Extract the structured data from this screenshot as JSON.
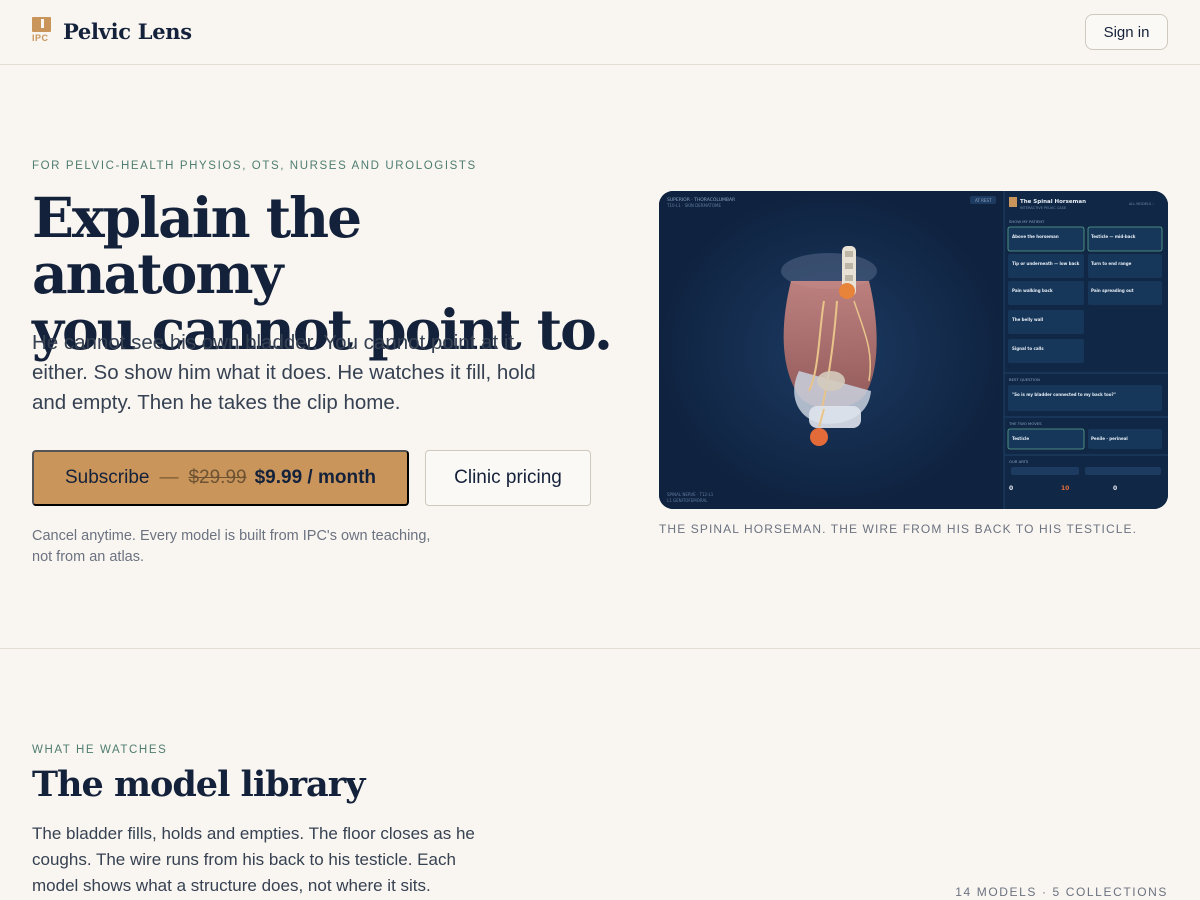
{
  "header": {
    "logo_text": "IPC",
    "brand": "Pelvic Lens",
    "signin_label": "Sign in"
  },
  "hero": {
    "eyebrow": "FOR PELVIC-HEALTH PHYSIOS, OTS, NURSES AND UROLOGISTS",
    "title_line1": "Explain the anatomy",
    "title_line2": "you cannot point to.",
    "subtitle": "He cannot see his own bladder. You cannot point at it either. So show him what it does. He watches it fill, hold and empty. Then he takes the clip home.",
    "subscribe": {
      "label": "Subscribe",
      "dash": "—",
      "old_price": "$29.99",
      "new_price": "$9.99 / month"
    },
    "clinic_label": "Clinic pricing",
    "fine_print": "Cancel anytime. Every model is built from IPC's own teaching, not from an atlas.",
    "caption": "THE SPINAL HORSEMAN. THE WIRE FROM HIS BACK TO HIS TESTICLE."
  },
  "preview": {
    "panel_title": "The Spinal Horseman",
    "panel_subtitle": "INTERACTIVE PELVIC CASE",
    "cards": [
      {
        "title": "Above the horseman"
      },
      {
        "title": "Testicle — mid-back"
      },
      {
        "title": "Tip or underneath — low back"
      },
      {
        "title": "Turn to end range"
      },
      {
        "title": "Pain walking back"
      },
      {
        "title": "Pain spreading out"
      },
      {
        "title": "The belly wall"
      },
      {
        "title": "Signal to calls"
      }
    ],
    "question": "\"So is my bladder connected to my back too?\"",
    "pair_left": "Testicle",
    "pair_right": "Penile · perineal",
    "stats": [
      {
        "value": "0"
      },
      {
        "value": "10"
      },
      {
        "value": "0"
      }
    ],
    "colors": {
      "panel_bg": "#0f2340",
      "card_bg": "#16375a",
      "card_border_active": "#5ea58e",
      "accent": "#e8833a",
      "stat_accent": "#e36b3a"
    }
  },
  "library": {
    "eyebrow": "WHAT HE WATCHES",
    "title": "The model library",
    "body": "The bladder fills, holds and empties. The floor closes as he coughs. The wire runs from his back to his testicle. Each model shows what a structure does, not where it sits.",
    "count": "14 MODELS · 5 COLLECTIONS"
  }
}
